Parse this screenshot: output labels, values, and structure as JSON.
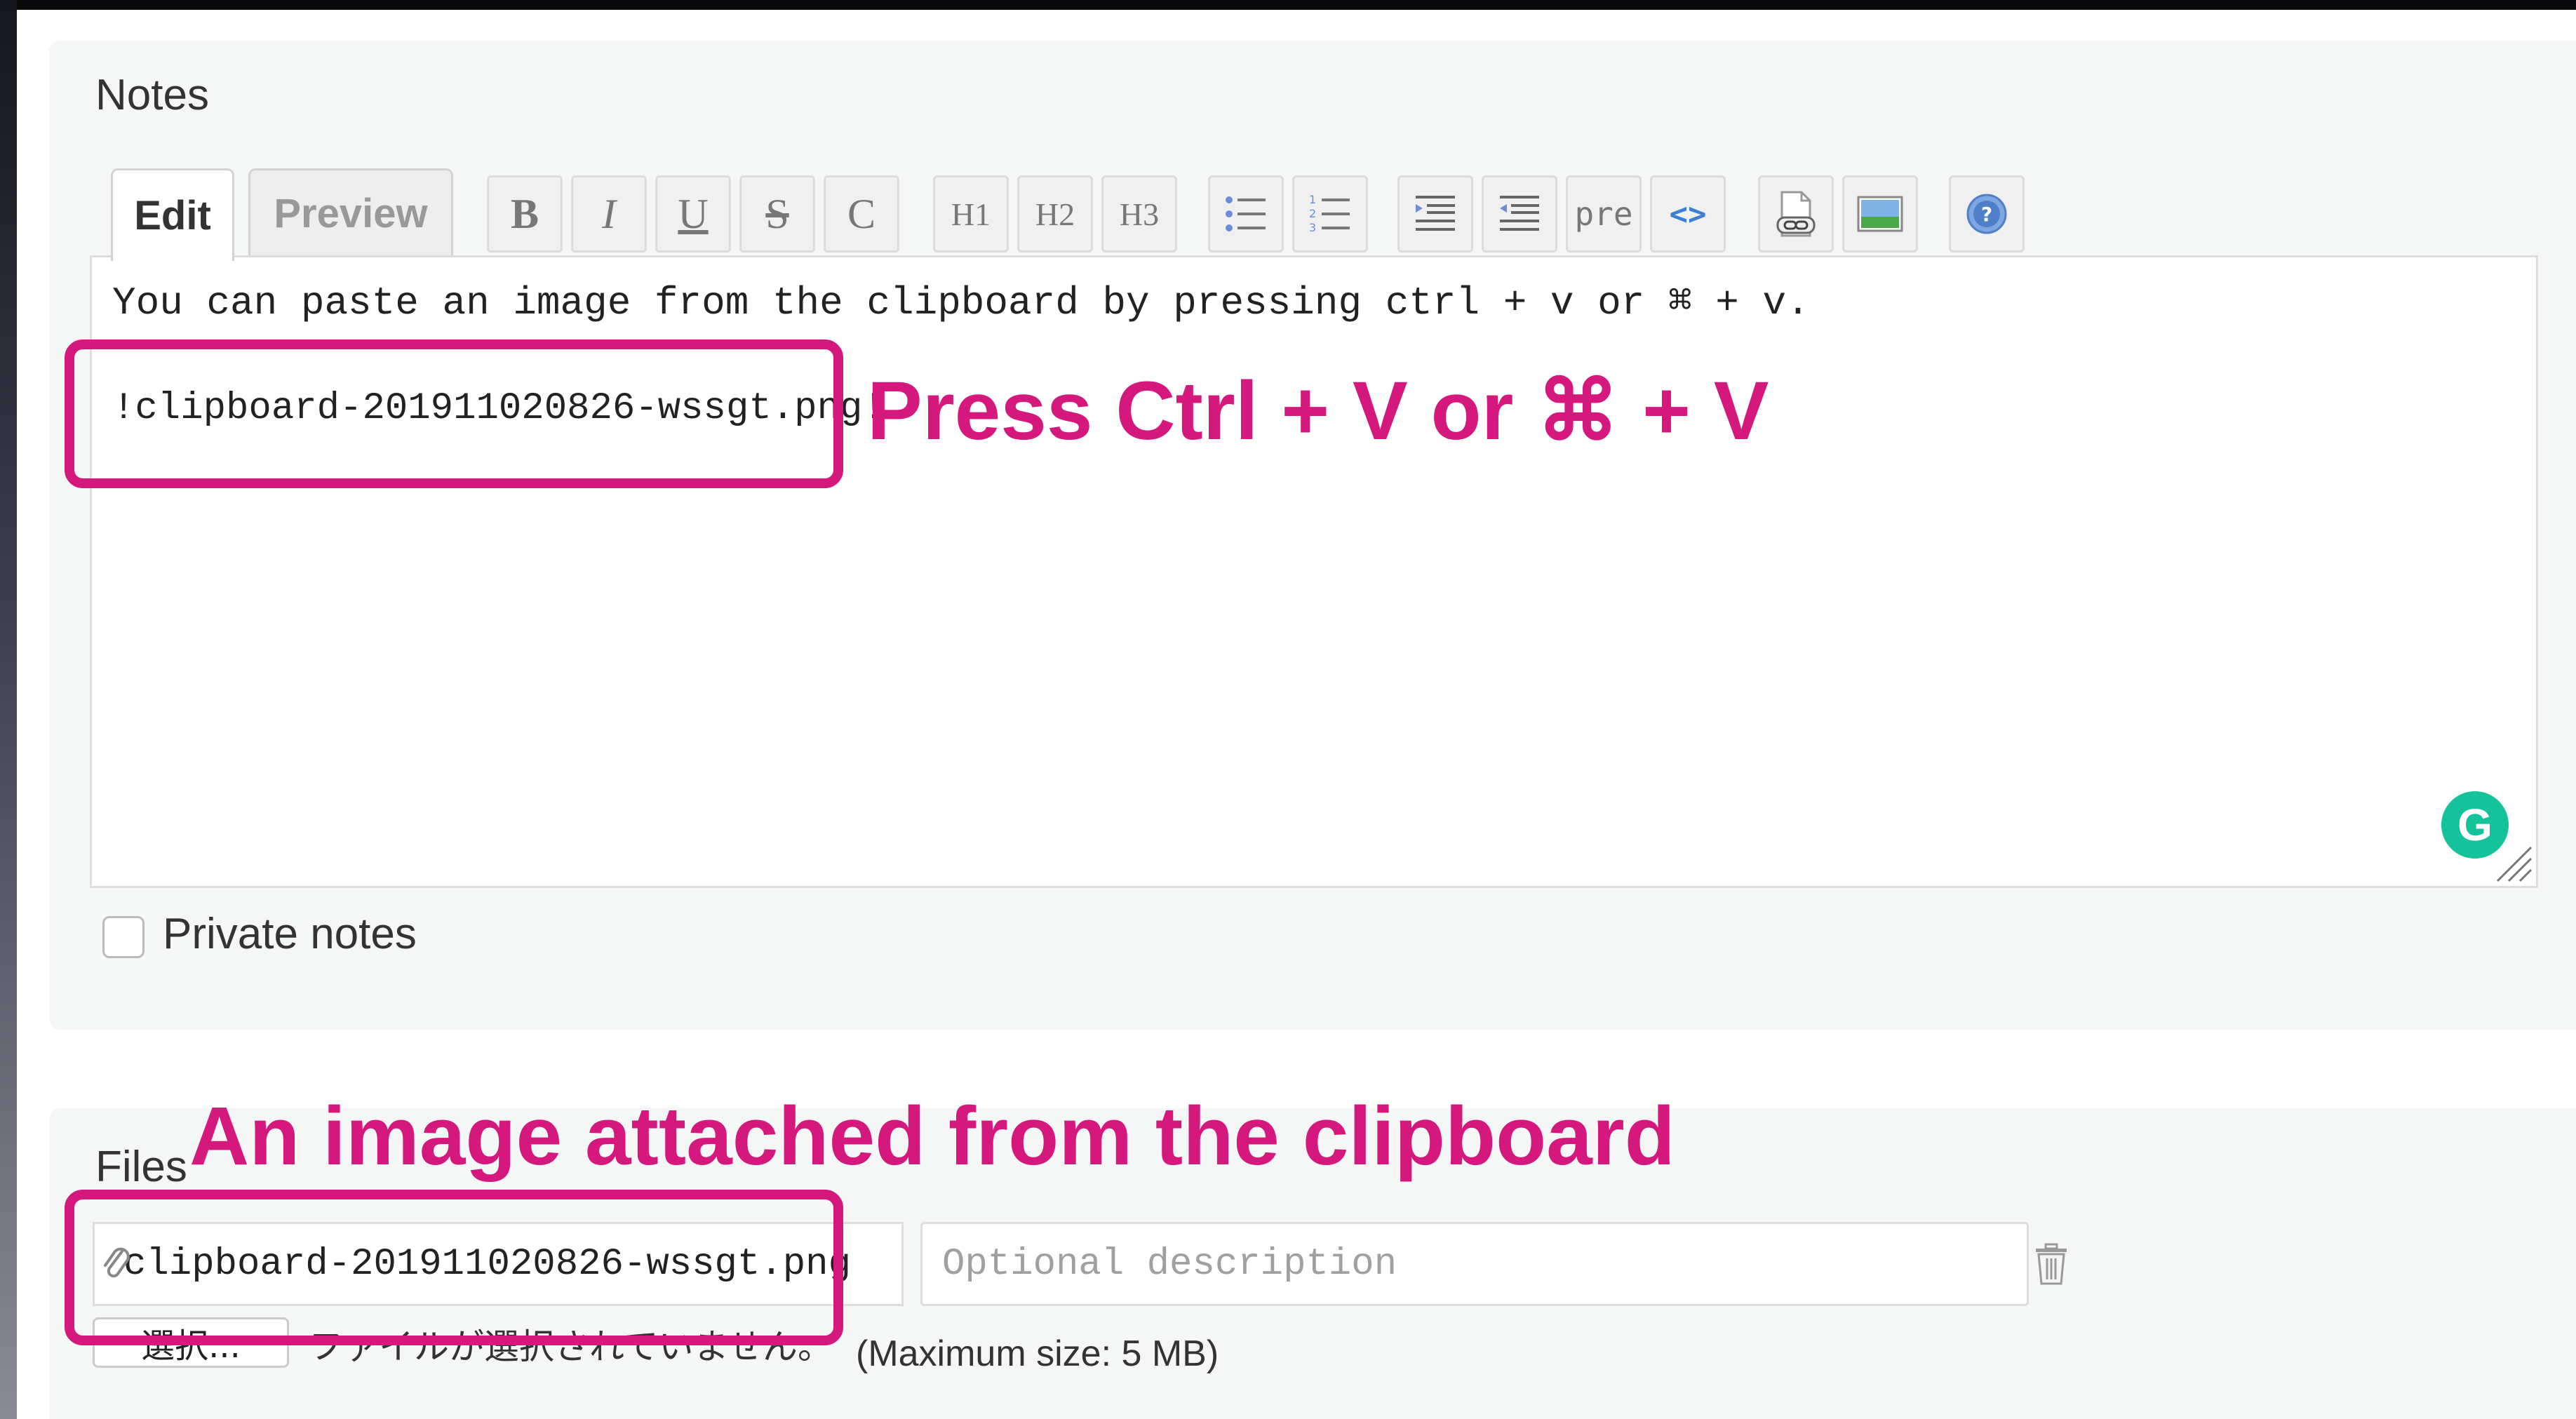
{
  "notes": {
    "title": "Notes",
    "tabs": [
      {
        "label": "Edit",
        "active": true
      },
      {
        "label": "Preview",
        "active": false
      }
    ],
    "toolbar": [
      {
        "label": "B",
        "icon": "bold-icon"
      },
      {
        "label": "I",
        "icon": "italic-icon"
      },
      {
        "label": "U",
        "icon": "underline-icon"
      },
      {
        "label": "S",
        "icon": "strikethrough-icon"
      },
      {
        "label": "C",
        "icon": "code-icon"
      },
      {
        "label": "H1",
        "icon": "heading1-icon"
      },
      {
        "label": "H2",
        "icon": "heading2-icon"
      },
      {
        "label": "H3",
        "icon": "heading3-icon"
      },
      {
        "label": "",
        "icon": "unordered-list-icon"
      },
      {
        "label": "",
        "icon": "ordered-list-icon"
      },
      {
        "label": "",
        "icon": "indent-icon"
      },
      {
        "label": "",
        "icon": "outdent-icon"
      },
      {
        "label": "pre",
        "icon": "preformatted-icon"
      },
      {
        "label": "<>",
        "icon": "highlighted-code-icon"
      },
      {
        "label": "",
        "icon": "link-page-icon"
      },
      {
        "label": "",
        "icon": "image-icon"
      },
      {
        "label": "",
        "icon": "help-icon"
      }
    ],
    "editor_lines": [
      "You can paste an image from the clipboard by pressing ctrl + v or ⌘ + v.",
      "!clipboard-201911020826-wssgt.png!"
    ],
    "private_notes_label": "Private notes",
    "private_notes_checked": false,
    "grammarly_letter": "G"
  },
  "files": {
    "title": "Files",
    "attached_file_name": "clipboard-201911020826-wssgt.png",
    "description_placeholder": "Optional description",
    "choose_button_label": "選択...",
    "no_file_text": "ファイルが選択されていません。",
    "max_size_text": "(Maximum size: 5 MB)"
  },
  "annotations": {
    "paste_hint": "Press Ctrl + V or ⌘ + V",
    "attached_hint": "An image attached from the clipboard"
  },
  "colors": {
    "annotation": "#d4187d",
    "panel_bg": "#f5f6f6",
    "grammarly": "#15c39a"
  }
}
